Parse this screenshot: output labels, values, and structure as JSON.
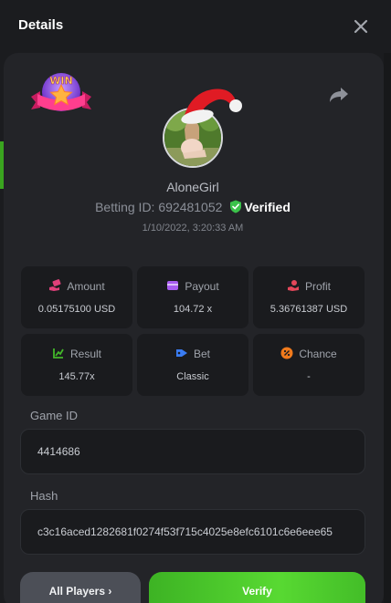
{
  "header": {
    "title": "Details"
  },
  "badge": {
    "text": "WIN"
  },
  "player": {
    "name": "AloneGirl",
    "betting_id_label": "Betting ID:",
    "betting_id": "692481052",
    "verified_label": "Verified",
    "date": "1/10/2022, 3:20:33 AM"
  },
  "stats": [
    {
      "label": "Amount",
      "value": "0.05175100 USD",
      "icon": "money-hand-icon",
      "color": "#e0407a"
    },
    {
      "label": "Payout",
      "value": "104.72 x",
      "icon": "wallet-icon",
      "color": "#a85cf0"
    },
    {
      "label": "Profit",
      "value": "5.36761387 USD",
      "icon": "profit-hand-icon",
      "color": "#e4475a"
    },
    {
      "label": "Result",
      "value": "145.77x",
      "icon": "result-icon",
      "color": "#43b72a"
    },
    {
      "label": "Bet",
      "value": "Classic",
      "icon": "tag-icon",
      "color": "#3a7cf2"
    },
    {
      "label": "Chance",
      "value": "-",
      "icon": "percent-icon",
      "color": "#f07a1c"
    }
  ],
  "game_id": {
    "label": "Game ID",
    "value": "4414686"
  },
  "hash": {
    "label": "Hash",
    "value": "c3c16aced1282681f0274f53f715c4025e8efc6101c6e6eee65"
  },
  "buttons": {
    "all_players": "All Players ›",
    "verify": "Verify"
  },
  "colors": {
    "accent": "#4ec72b",
    "panel": "#232428",
    "card": "#1a1b1e"
  }
}
